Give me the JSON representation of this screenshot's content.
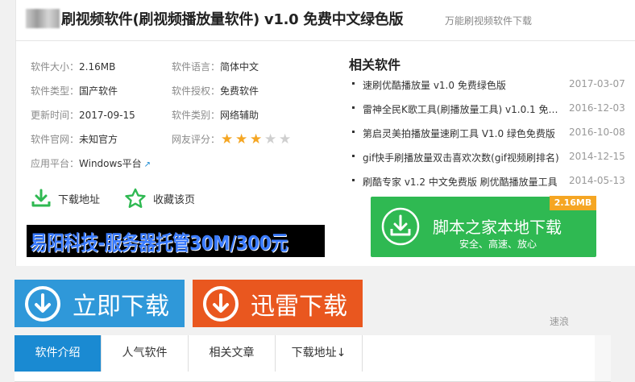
{
  "header": {
    "title": "刷视频软件(刷视频播放量软件) v1.0 免费中文绿色版",
    "subtitle": "万能刷视频软件下载"
  },
  "info": {
    "size": {
      "label": "软件大小：",
      "value": "2.16MB"
    },
    "language": {
      "label": "软件语言：",
      "value": "简体中文"
    },
    "type": {
      "label": "软件类型：",
      "value": "国产软件"
    },
    "license": {
      "label": "软件授权：",
      "value": "免费软件"
    },
    "updated": {
      "label": "更新时间：",
      "value": "2017-09-15"
    },
    "category": {
      "label": "软件类别：",
      "value": "网络辅助"
    },
    "website": {
      "label": "软件官网：",
      "value": "未知官方"
    },
    "rating": {
      "label": "网友评分：",
      "stars": 3,
      "max": 5
    },
    "platform": {
      "label": "应用平台：",
      "value": "Windows平台"
    }
  },
  "actions": {
    "download_address": "下载地址",
    "favorite": "收藏该页"
  },
  "ad_banner": "易阳科技-服务器托管30M/300元",
  "related": {
    "title": "相关软件",
    "items": [
      {
        "name": "速刷优酷播放量 v1.0 免费绿色版",
        "date": "2017-03-07"
      },
      {
        "name": "雷神全民K歌工具(刷播放量工具) v1.0.1 免费版",
        "date": "2016-12-03"
      },
      {
        "name": "第启灵美拍播放量速刷工具 V1.0 绿色免费版",
        "date": "2016-10-08"
      },
      {
        "name": "gif快手刷播放量双击喜欢次数(gif视频刷排名)",
        "date": "2014-12-15"
      },
      {
        "name": "刷酷专家 v1.2 中文免费版 刷优酷播放量工具",
        "date": "2014-05-13"
      }
    ]
  },
  "local_download": {
    "label": "脚本之家本地下载",
    "sub": "安全、高速、放心",
    "size_badge": "2.16MB"
  },
  "buttons": {
    "download_now": "立即下载",
    "thunder_download": "迅雷下载"
  },
  "speed_text": "速浪",
  "tabs": [
    "软件介绍",
    "人气软件",
    "相关文章",
    "下载地址↓"
  ],
  "colors": {
    "accent_blue": "#2f98d9",
    "accent_orange": "#e9571f",
    "download_green": "#2fb952",
    "star": "#f5a623",
    "tab_active": "#1a8ad2"
  }
}
